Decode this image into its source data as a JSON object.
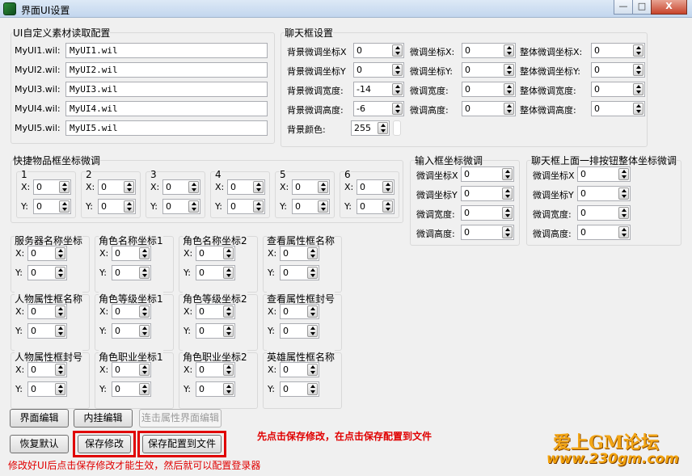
{
  "window": {
    "title": "界面UI设置",
    "min": "—",
    "max": "□",
    "close": "X"
  },
  "ui_group": {
    "title": "UI自定义素材读取配置",
    "rows": [
      {
        "label": "MyUI1.wil:",
        "value": "MyUI1.wil"
      },
      {
        "label": "MyUI2.wil:",
        "value": "MyUI2.wil"
      },
      {
        "label": "MyUI3.wil:",
        "value": "MyUI3.wil"
      },
      {
        "label": "MyUI4.wil:",
        "value": "MyUI4.wil"
      },
      {
        "label": "MyUI5.wil:",
        "value": "MyUI5.wil"
      }
    ]
  },
  "chat_group": {
    "title": "聊天框设置",
    "col1": [
      {
        "label": "背景微调坐标X",
        "value": "0"
      },
      {
        "label": "背景微调坐标Y",
        "value": "0"
      },
      {
        "label": "背景微调宽度:",
        "value": "-14"
      },
      {
        "label": "背景微调高度:",
        "value": "-6"
      }
    ],
    "col2": [
      {
        "label": "微调坐标X:",
        "value": "0"
      },
      {
        "label": "微调坐标Y:",
        "value": "0"
      },
      {
        "label": "微调宽度:",
        "value": "0"
      },
      {
        "label": "微调高度:",
        "value": "0"
      }
    ],
    "col3": [
      {
        "label": "整体微调坐标X:",
        "value": "0"
      },
      {
        "label": "整体微调坐标Y:",
        "value": "0"
      },
      {
        "label": "整体微调宽度:",
        "value": "0"
      },
      {
        "label": "整体微调高度:",
        "value": "0"
      }
    ],
    "bg_color_label": "背景颜色:",
    "bg_color_value": "255"
  },
  "quick_group": {
    "title": "快捷物品框坐标微调",
    "x_label": "X:",
    "y_label": "Y:",
    "slots": [
      {
        "num": "1",
        "x": "0",
        "y": "0"
      },
      {
        "num": "2",
        "x": "0",
        "y": "0"
      },
      {
        "num": "3",
        "x": "0",
        "y": "0"
      },
      {
        "num": "4",
        "x": "0",
        "y": "0"
      },
      {
        "num": "5",
        "x": "0",
        "y": "0"
      },
      {
        "num": "6",
        "x": "0",
        "y": "0"
      }
    ]
  },
  "input_group": {
    "title": "输入框坐标微调",
    "rows": [
      {
        "label": "微调坐标X",
        "value": "0"
      },
      {
        "label": "微调坐标Y",
        "value": "0"
      },
      {
        "label": "微调宽度:",
        "value": "0"
      },
      {
        "label": "微调高度:",
        "value": "0"
      }
    ]
  },
  "chatbtn_group": {
    "title": "聊天框上面一排按钮整体坐标微调",
    "rows": [
      {
        "label": "微调坐标X",
        "value": "0"
      },
      {
        "label": "微调坐标Y",
        "value": "0"
      },
      {
        "label": "微调宽度:",
        "value": "0"
      },
      {
        "label": "微调高度:",
        "value": "0"
      }
    ]
  },
  "coord_groups": [
    {
      "title": "服务器名称坐标",
      "x": "0",
      "y": "0"
    },
    {
      "title": "角色名称坐标1",
      "x": "0",
      "y": "0"
    },
    {
      "title": "角色名称坐标2",
      "x": "0",
      "y": "0"
    },
    {
      "title": "查看属性框名称",
      "x": "0",
      "y": "0"
    },
    {
      "title": "人物属性框名称",
      "x": "0",
      "y": "0"
    },
    {
      "title": "角色等级坐标1",
      "x": "0",
      "y": "0"
    },
    {
      "title": "角色等级坐标2",
      "x": "0",
      "y": "0"
    },
    {
      "title": "查看属性框封号",
      "x": "0",
      "y": "0"
    },
    {
      "title": "人物属性框封号",
      "x": "0",
      "y": "0"
    },
    {
      "title": "角色职业坐标1",
      "x": "0",
      "y": "0"
    },
    {
      "title": "角色职业坐标2",
      "x": "0",
      "y": "0"
    },
    {
      "title": "英雄属性框名称",
      "x": "0",
      "y": "0"
    }
  ],
  "coord_x_label": "X:",
  "coord_y_label": "Y:",
  "buttons": {
    "ui_edit": "界面编辑",
    "plugin_edit": "内挂编辑",
    "attr_edit": "连击属性界面编辑",
    "restore": "恢复默认",
    "save": "保存修改",
    "save_file": "保存配置到文件"
  },
  "note": "先点击保存修改，在点击保存配置到文件",
  "hint": "修改好UI后点击保存修改才能生效，然后就可以配置登录器",
  "watermark": {
    "line1": "爱上GM论坛",
    "line2": "www.230gm.com"
  }
}
